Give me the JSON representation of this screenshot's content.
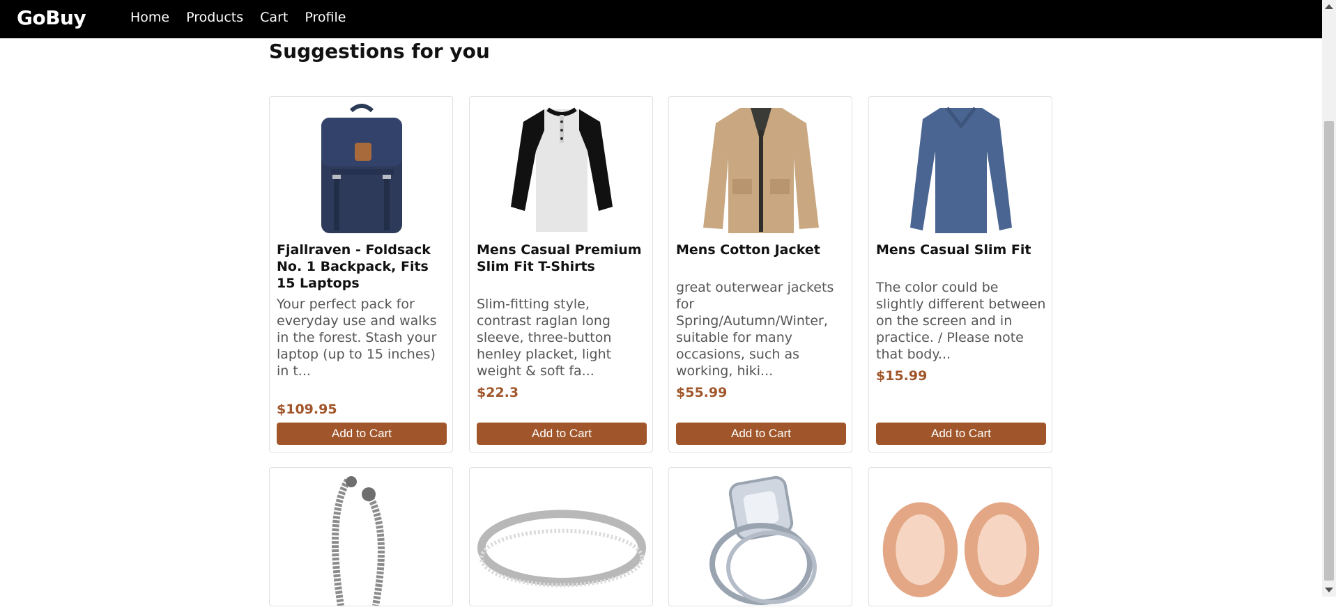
{
  "nav": {
    "brand": "GoBuy",
    "links": [
      "Home",
      "Products",
      "Cart",
      "Profile"
    ]
  },
  "page": {
    "heading": "Suggestions for you"
  },
  "products": [
    {
      "title": "Fjallraven - Foldsack No. 1 Backpack, Fits 15 Laptops",
      "description": "Your perfect pack for everyday use and walks in the forest. Stash your laptop (up to 15 inches) in t...",
      "price": "$109.95",
      "button": "Add to Cart",
      "image_icon": "backpack-image"
    },
    {
      "title": "Mens Casual Premium Slim Fit T-Shirts",
      "description": "Slim-fitting style, contrast raglan long sleeve, three-button henley placket, light weight & soft fa...",
      "price": "$22.3",
      "button": "Add to Cart",
      "image_icon": "tshirt-image"
    },
    {
      "title": "Mens Cotton Jacket",
      "description": "great outerwear jackets for Spring/Autumn/Winter, suitable for many occasions, such as working, hiki...",
      "price": "$55.99",
      "button": "Add to Cart",
      "image_icon": "jacket-image"
    },
    {
      "title": "Mens Casual Slim Fit",
      "description": "The color could be slightly different between on the screen and in practice. / Please note that body...",
      "price": "$15.99",
      "button": "Add to Cart",
      "image_icon": "longsleeve-image"
    }
  ],
  "more_products": [
    {
      "image_icon": "bracelet-image"
    },
    {
      "image_icon": "ring-image"
    },
    {
      "image_icon": "diamond-ring-image"
    },
    {
      "image_icon": "earring-plugs-image"
    }
  ],
  "colors": {
    "navbar": "#000000",
    "accent": "#a0562a",
    "description": "#555555"
  }
}
